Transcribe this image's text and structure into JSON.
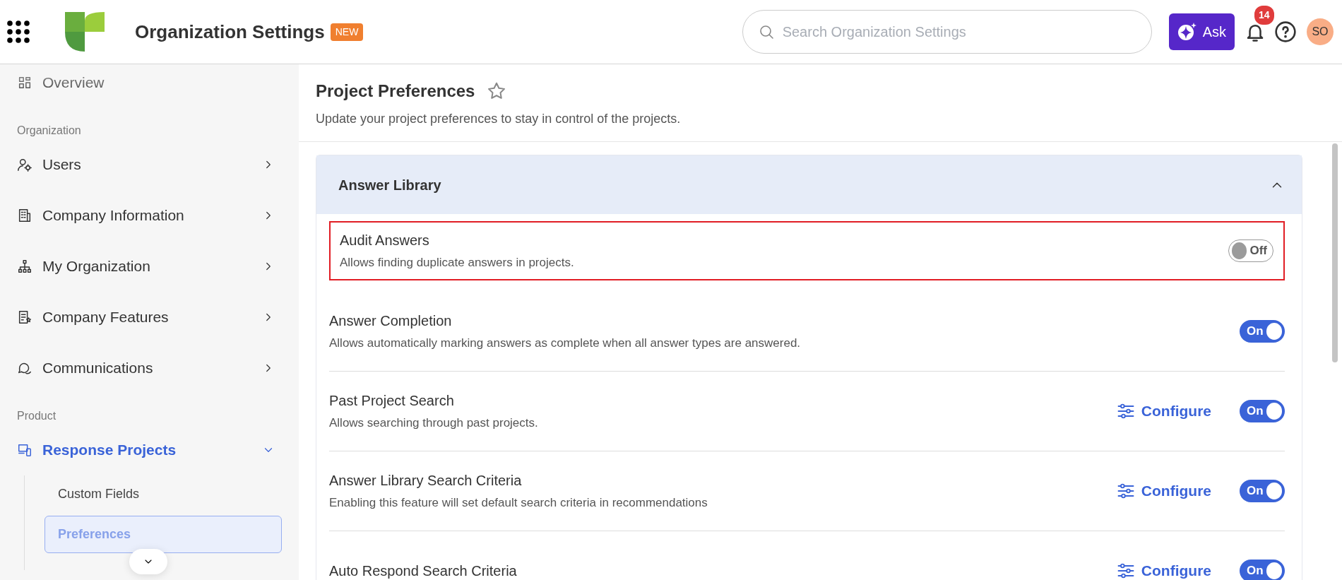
{
  "header": {
    "title": "Organization Settings",
    "badge": "NEW",
    "search": {
      "placeholder": "Search Organization Settings"
    },
    "ask_button": "Ask",
    "notifications_count": "14",
    "avatar": "SO"
  },
  "sidebar": {
    "items": [
      {
        "kind": "item",
        "label": "Overview"
      },
      {
        "kind": "section",
        "label": "Organization"
      },
      {
        "kind": "item",
        "label": "Users",
        "expanded": false
      },
      {
        "kind": "item",
        "label": "Company Information",
        "expanded": false
      },
      {
        "kind": "item",
        "label": "My Organization",
        "expanded": false
      },
      {
        "kind": "item",
        "label": "Company Features",
        "expanded": false
      },
      {
        "kind": "item",
        "label": "Communications",
        "expanded": false
      },
      {
        "kind": "section",
        "label": "Product"
      },
      {
        "kind": "item",
        "label": "Response Projects",
        "expanded": true,
        "children": [
          {
            "label": "Custom Fields",
            "selected": false
          },
          {
            "label": "Preferences",
            "selected": true
          }
        ]
      }
    ]
  },
  "page": {
    "title": "Project Preferences",
    "favorite": false,
    "subtitle": "Update your project preferences to stay in control of the projects."
  },
  "panel": {
    "title": "Answer Library",
    "expanded": true,
    "settings": [
      {
        "title": "Audit Answers",
        "description": "Allows finding duplicate answers in projects.",
        "highlighted": true,
        "on": false,
        "toggle_label": "Off"
      },
      {
        "title": "Answer Completion",
        "description": "Allows automatically marking answers as complete when all answer types are answered.",
        "highlighted": false,
        "on": true,
        "toggle_label": "On"
      },
      {
        "title": "Past Project Search",
        "description": "Allows searching through past projects.",
        "highlighted": false,
        "configure": "Configure",
        "on": true,
        "toggle_label": "On"
      },
      {
        "title": "Answer Library Search Criteria",
        "description": "Enabling this feature will set default search criteria in recommendations",
        "highlighted": false,
        "configure": "Configure",
        "on": true,
        "toggle_label": "On"
      },
      {
        "title": "Auto Respond Search Criteria",
        "highlighted": false,
        "configure": "Configure",
        "on": true,
        "toggle_label": "On"
      }
    ]
  }
}
